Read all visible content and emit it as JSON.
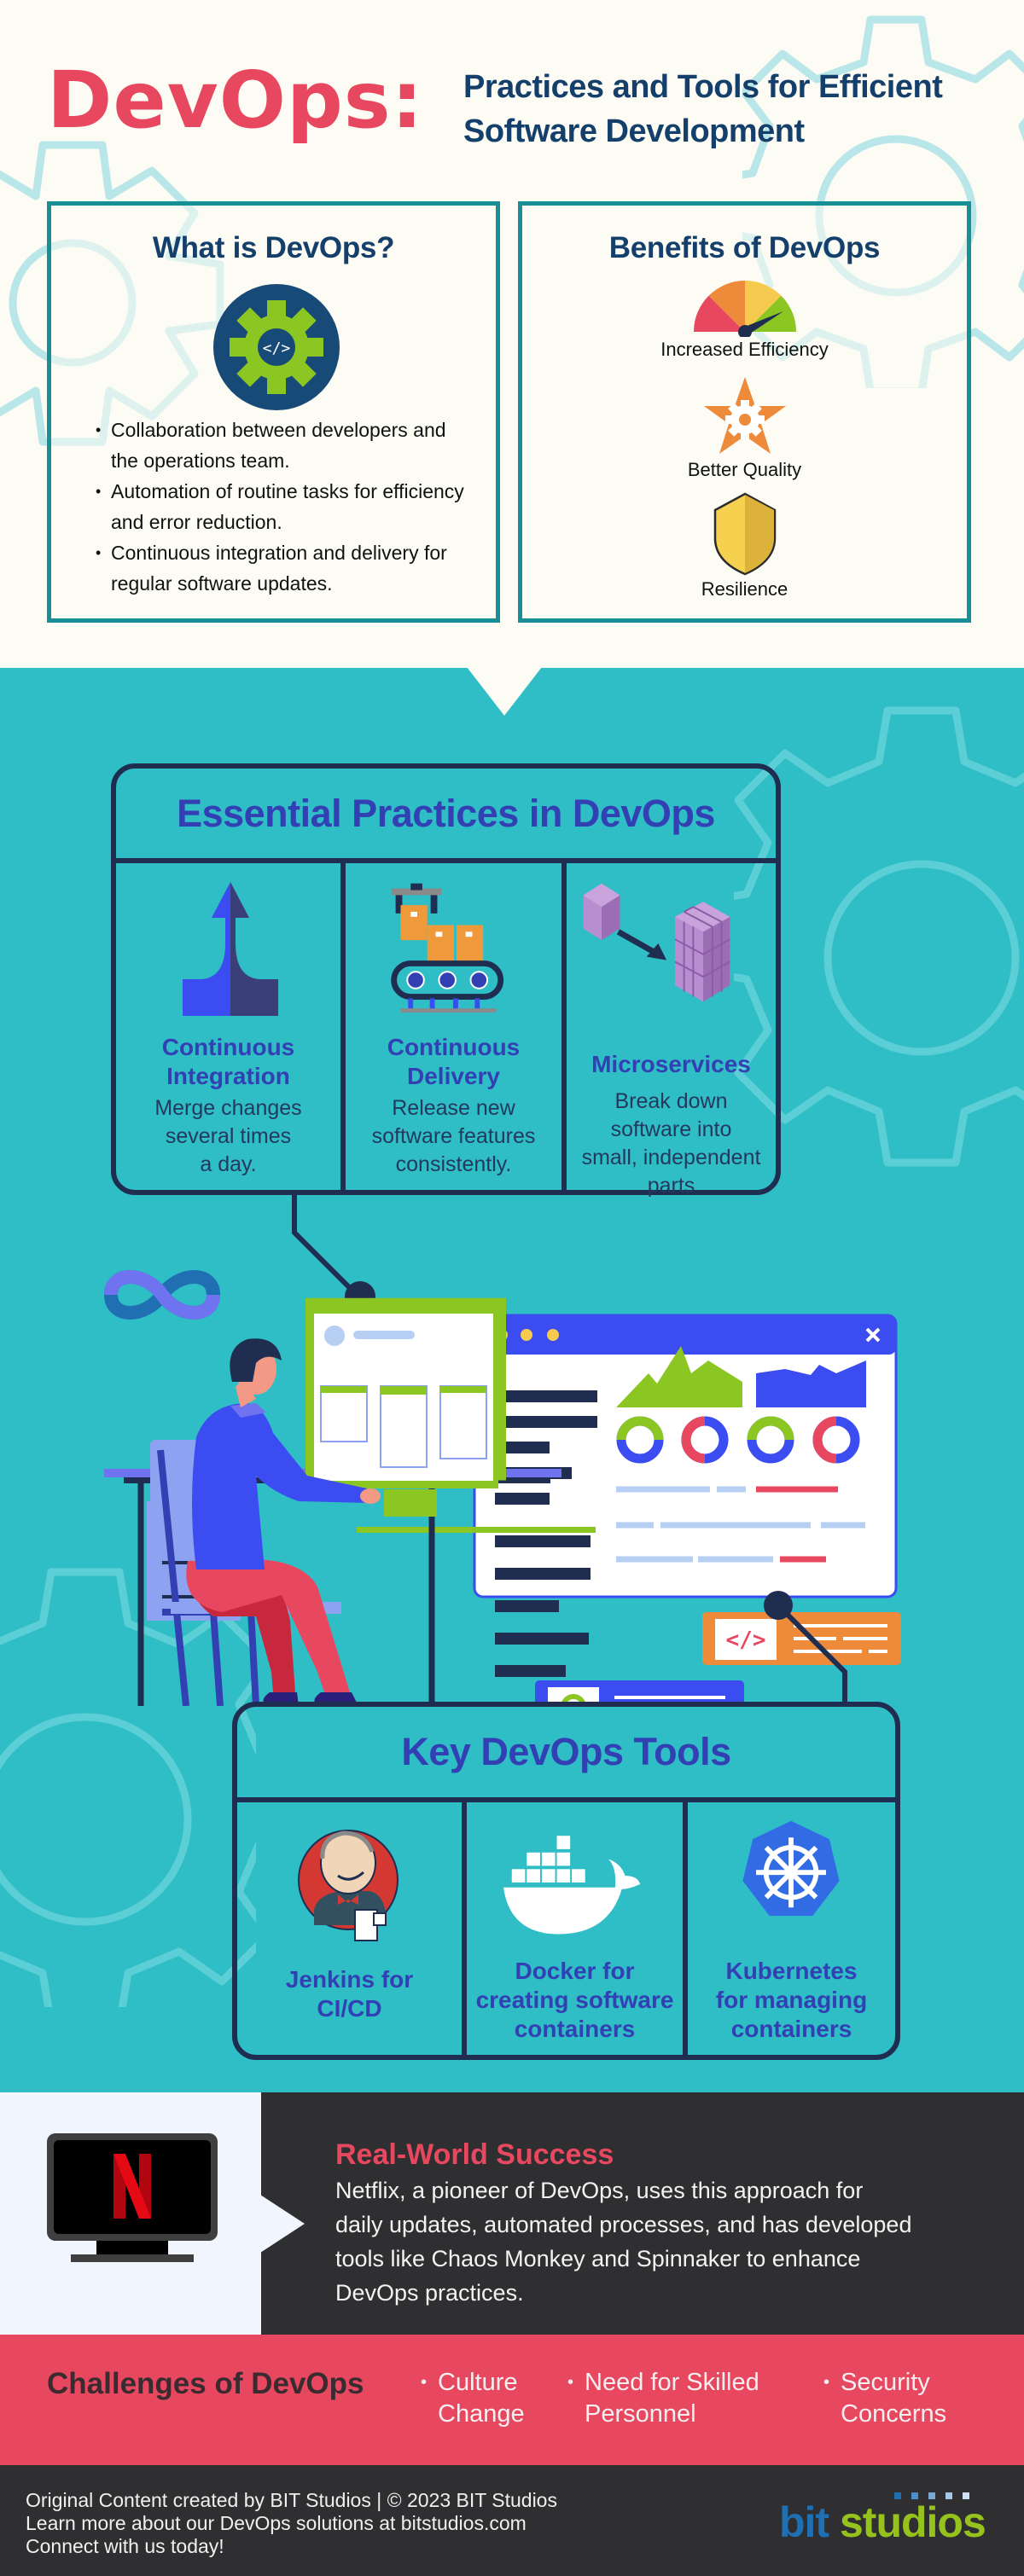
{
  "header": {
    "title": "DevOps:",
    "subtitle_line1": "Practices and Tools for Efficient",
    "subtitle_line2": "Software Development"
  },
  "what_is": {
    "heading": "What is DevOps?",
    "icon": "gear-code-icon",
    "bullets": [
      "Collaboration between developers and the operations team.",
      "Automation of routine tasks for efficiency and error reduction.",
      "Continuous integration and delivery for regular software updates."
    ]
  },
  "benefits": {
    "heading": "Benefits of DevOps",
    "items": [
      {
        "label": "Increased Efficiency",
        "icon": "speedometer-icon"
      },
      {
        "label": "Better Quality",
        "icon": "star-gear-icon"
      },
      {
        "label": "Resilience",
        "icon": "shield-icon"
      }
    ]
  },
  "practices": {
    "heading": "Essential Practices in DevOps",
    "items": [
      {
        "title_line1": "Continuous",
        "title_line2": "Integration",
        "desc_line1": "Merge changes",
        "desc_line2": "several times",
        "desc_line3": "a day.",
        "icon": "merge-arrows-icon"
      },
      {
        "title_line1": "Continuous",
        "title_line2": "Delivery",
        "desc_line1": "Release new",
        "desc_line2": "software features",
        "desc_line3": "consistently.",
        "icon": "conveyor-belt-icon"
      },
      {
        "title_line1": "Microservices",
        "desc_line1": "Break down",
        "desc_line2": "software into",
        "desc_line3": "small, independent",
        "desc_line4": "parts",
        "icon": "cubes-icon"
      }
    ]
  },
  "tools": {
    "heading": "Key DevOps Tools",
    "items": [
      {
        "line1": "Jenkins for",
        "line2": "CI/CD",
        "icon": "jenkins-icon"
      },
      {
        "line1": "Docker for",
        "line2": "creating software",
        "line3": "containers",
        "icon": "docker-icon"
      },
      {
        "line1": "Kubernetes",
        "line2": "for managing",
        "line3": "containers",
        "icon": "kubernetes-icon"
      }
    ]
  },
  "success": {
    "title": "Real-World Success",
    "body_line1": "Netflix, a pioneer of DevOps, uses this approach for",
    "body_line2": "daily updates, automated processes, and has developed",
    "body_line3": "tools like Chaos Monkey and Spinnaker to enhance",
    "body_line4": "DevOps practices.",
    "icon": "netflix-tv-icon",
    "logo_letter": "N"
  },
  "challenges": {
    "title": "Challenges of DevOps",
    "items": [
      {
        "line1": "Culture",
        "line2": "Change"
      },
      {
        "line1": "Need for Skilled",
        "line2": "Personnel"
      },
      {
        "line1": "Security",
        "line2": "Concerns"
      }
    ]
  },
  "footer": {
    "line1": "Original Content created by BIT Studios | © 2023 BIT Studios",
    "line2": "Learn more about our DevOps solutions at bitstudios.com",
    "line3": "Connect with us today!",
    "logo_bit": "bit",
    "logo_studios": "studios"
  },
  "colors": {
    "brand_red": "#e8485f",
    "navy": "#143f6b",
    "teal": "#2fbdc6",
    "box_border": "#178f95",
    "card_title": "#3340b3",
    "dark": "#2f2f31",
    "logo_blue": "#1f6fb2",
    "logo_green": "#96c21e"
  }
}
